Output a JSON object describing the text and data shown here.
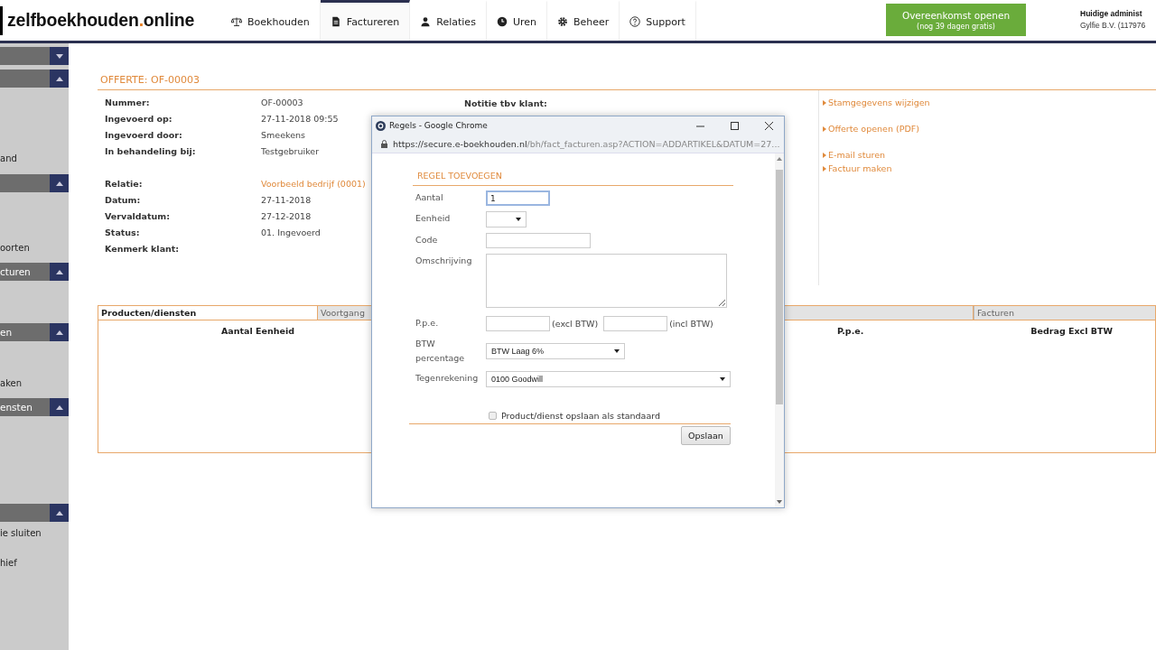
{
  "logo": {
    "name": "zelfboekhouden",
    "dot": ".",
    "suffix": "online"
  },
  "nav": [
    {
      "label": "Boekhouden",
      "selected": false
    },
    {
      "label": "Factureren",
      "selected": true
    },
    {
      "label": "Relaties",
      "selected": false
    },
    {
      "label": "Uren",
      "selected": false
    },
    {
      "label": "Beheer",
      "selected": false
    },
    {
      "label": "Support",
      "selected": false
    }
  ],
  "cta": {
    "title": "Overeenkomst openen",
    "subtitle": "(nog 39 dagen gratis)"
  },
  "account": {
    "label": "Huidige administ",
    "value": "Gylfie B.V. (117976"
  },
  "sidebar": [
    {
      "kind": "header",
      "expanded": false
    },
    {
      "kind": "header",
      "expanded": true
    },
    {
      "kind": "item",
      "label": "and"
    },
    {
      "kind": "header",
      "expanded": true
    },
    {
      "kind": "item",
      "label": "oorten"
    },
    {
      "kind": "header",
      "label": "cturen",
      "expanded": true
    },
    {
      "kind": "header",
      "label": "en",
      "expanded": true
    },
    {
      "kind": "item",
      "label": "aken"
    },
    {
      "kind": "header",
      "label": "ensten",
      "expanded": true
    },
    {
      "kind": "header",
      "expanded": true
    },
    {
      "kind": "item",
      "label": "ie sluiten"
    },
    {
      "kind": "item",
      "label": "hief"
    }
  ],
  "page_title": "OFFERTE: OF-00003",
  "details": [
    {
      "label": "Nummer:",
      "value": "OF-00003"
    },
    {
      "label": "Ingevoerd op:",
      "value": "27-11-2018 09:55"
    },
    {
      "label": "Ingevoerd door:",
      "value": "Smeekens"
    },
    {
      "label": "In behandeling bij:",
      "value": "Testgebruiker"
    },
    {
      "label": "Relatie:",
      "value": "Voorbeeld bedrijf (0001)",
      "kind": "link"
    },
    {
      "label": "Datum:",
      "value": "27-11-2018"
    },
    {
      "label": "Vervaldatum:",
      "value": "27-12-2018"
    },
    {
      "label": "Status:",
      "value": "01. Ingevoerd"
    },
    {
      "label": "Kenmerk klant:"
    }
  ],
  "note_label": "Notitie tbv klant:",
  "actions": [
    {
      "label": "Stamgegevens wijzigen"
    },
    {
      "label": "Offerte openen (PDF)"
    },
    {
      "label": "E-mail sturen"
    },
    {
      "label": "Factuur maken"
    }
  ],
  "tabs": [
    {
      "label": "Producten/diensten",
      "selected": true
    },
    {
      "label": "Voortgang",
      "selected": false
    },
    {
      "label": "Facturen",
      "selected": false
    }
  ],
  "columns": [
    "Aantal Eenheid",
    "P.p.e.",
    "Bedrag Excl BTW"
  ],
  "popup": {
    "title": "Regels - Google Chrome",
    "url_host": "https://secure.e-boekhouden.nl",
    "url_path": "/bh/fact_facturen.asp?ACTION=ADDARTIKEL&DATUM=27...",
    "heading": "REGEL TOEVOEGEN",
    "fields": [
      {
        "label": "Aantal",
        "kind": "text",
        "value": "1",
        "focused": true
      },
      {
        "label": "Eenheid",
        "kind": "select"
      },
      {
        "label": "Code",
        "kind": "text",
        "focused": false
      },
      {
        "label": "Omschrijving",
        "kind": "textarea"
      },
      {
        "label": "P.p.e.",
        "kind": "price",
        "excl_label": "(excl BTW)",
        "incl_label": "(incl BTW)"
      },
      {
        "label": "BTW percentage",
        "kind": "select",
        "value": "BTW Laag 6%"
      },
      {
        "label": "Tegenrekening",
        "kind": "wideselect",
        "value": "0100 Goodwill"
      }
    ],
    "checkbox": {
      "label": "Product/dienst opslaan als standaard",
      "checked": false
    },
    "save": "Opslaan"
  }
}
